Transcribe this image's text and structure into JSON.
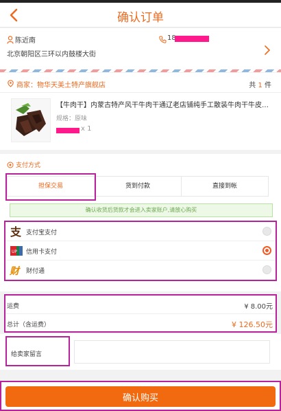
{
  "header": {
    "title": "确认订单"
  },
  "address": {
    "name": "陈近南",
    "phone": "18",
    "address": "北京朝阳区三环以内鼓楼大街"
  },
  "shop": {
    "label": "商家：物华天美土特产旗舰店",
    "count_prefix": "共",
    "count": "1",
    "count_suffix": "件",
    "product": {
      "title": "【牛肉干】内蒙古特产风干牛肉干通辽老店铺纯手工散装牛肉干牛皮纸...",
      "spec": "规格：原味",
      "qty": "x 1"
    }
  },
  "payment": {
    "title": "支付方式",
    "tabs": [
      {
        "label": "担保交易"
      },
      {
        "label": "货到付款"
      },
      {
        "label": "直接到帐"
      }
    ],
    "notice": "确认收货后货款才会进入卖家账户,请放心购买",
    "methods": [
      {
        "label": "支付宝支付",
        "icon": "alipay-icon",
        "selected": false
      },
      {
        "label": "信用卡支付",
        "icon": "credit-card-icon",
        "selected": true
      },
      {
        "label": "财付通",
        "icon": "tenpay-icon",
        "selected": false
      }
    ]
  },
  "totals": {
    "shipping_label": "运费",
    "shipping_value": "¥ 8.00元",
    "total_label": "总计（含运费）",
    "total_value": "¥ 126.50元"
  },
  "message": {
    "label": "给卖家留言",
    "placeholder": ""
  },
  "footer": {
    "buy_label": "确认购买"
  },
  "colors": {
    "accent": "#ee6a1f",
    "highlight": "#b5229a",
    "button": "#f26a10"
  }
}
